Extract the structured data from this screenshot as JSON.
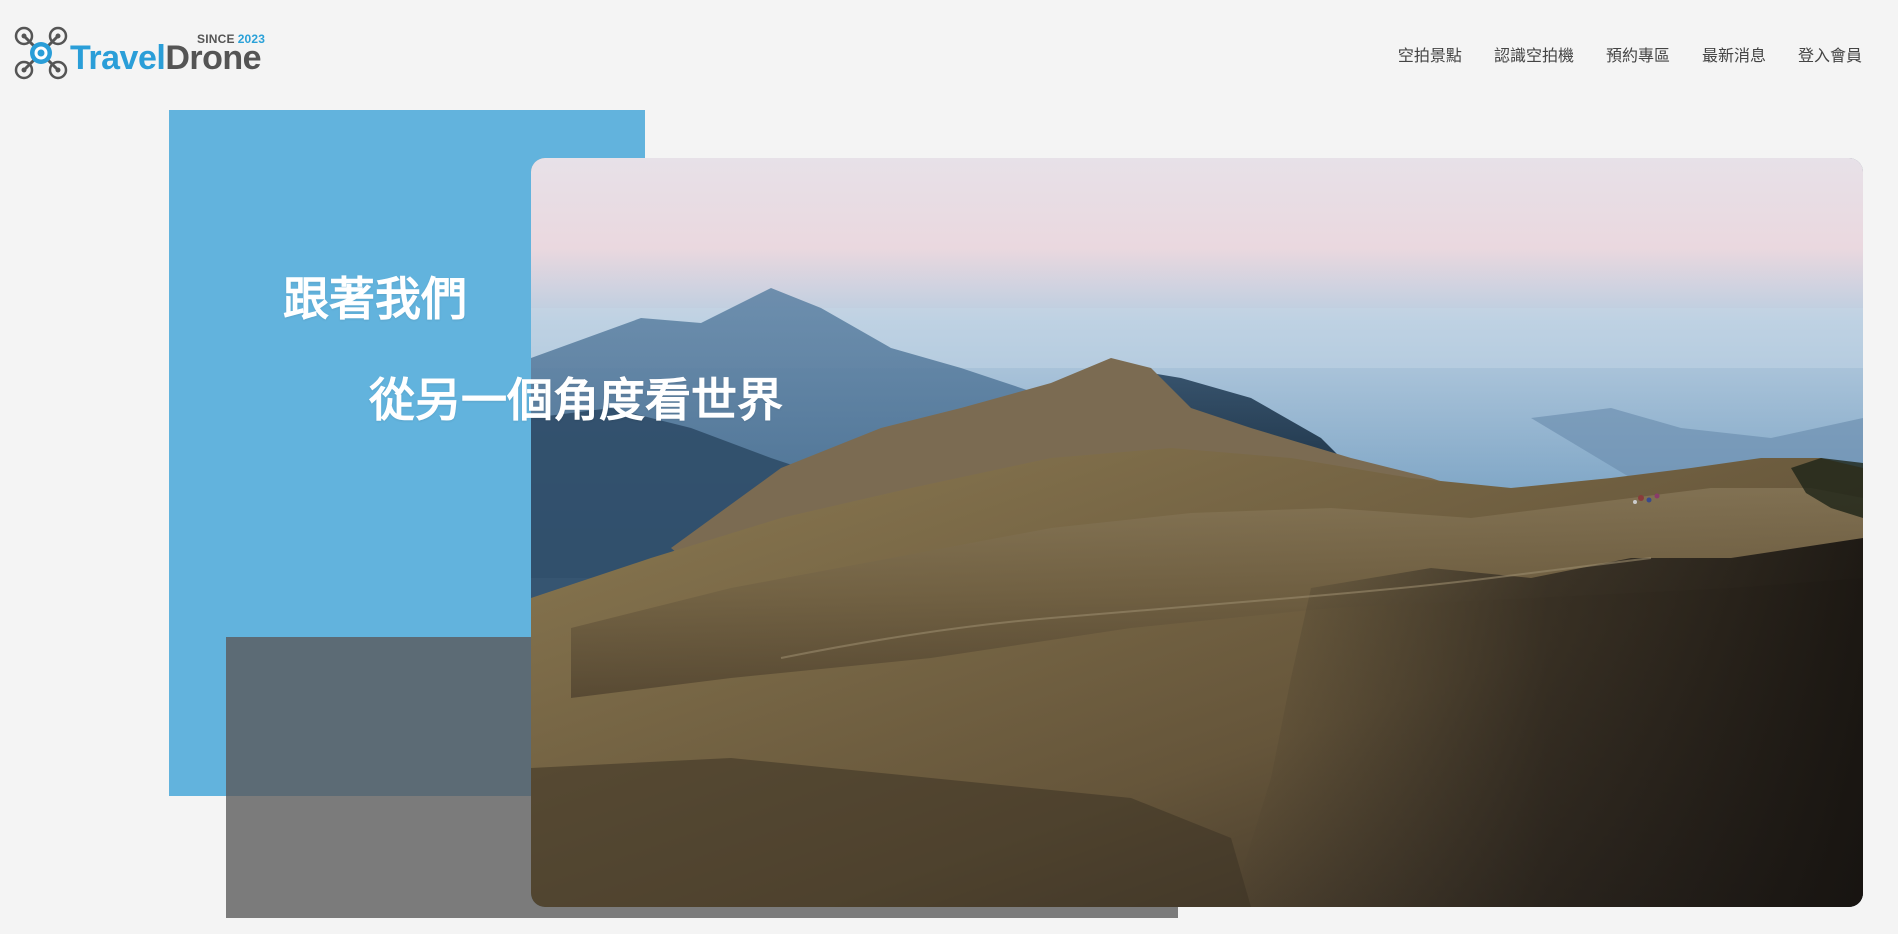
{
  "brand": {
    "since_label": "SINCE",
    "since_year": "2023",
    "name_part1": "Travel",
    "name_part2": "Drone",
    "icon": "drone-icon",
    "colors": {
      "primary": "#2a9ed8",
      "secondary": "#555555"
    }
  },
  "nav": {
    "items": [
      {
        "label": "空拍景點"
      },
      {
        "label": "認識空拍機"
      },
      {
        "label": "預約專區"
      },
      {
        "label": "最新消息"
      },
      {
        "label": "登入會員"
      }
    ]
  },
  "hero": {
    "headline_line1": "跟著我們",
    "headline_line2": "從另一個角度看世界",
    "colors": {
      "blue_panel": "#62b3dd",
      "gray_panel": "#7b7b7b",
      "background": "#f4f4f4"
    }
  }
}
